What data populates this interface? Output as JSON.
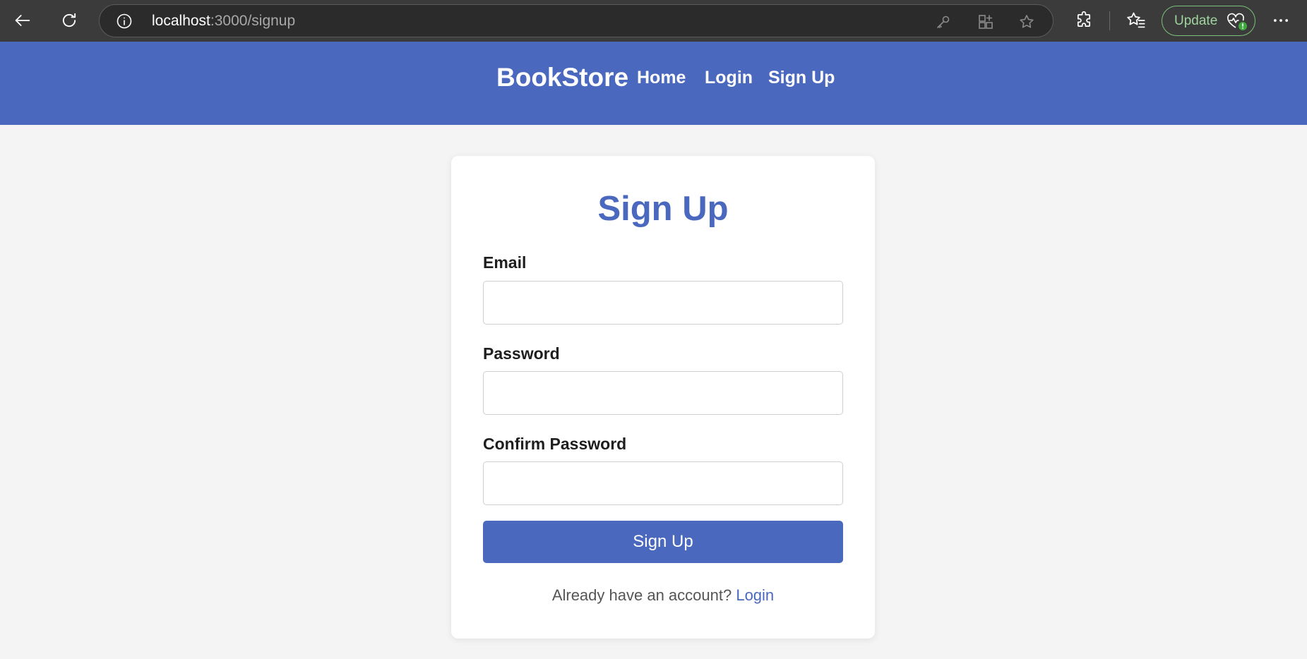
{
  "browser": {
    "url_host": "localhost",
    "url_path": ":3000/signup",
    "update_label": "Update",
    "icons": [
      "back-arrow-icon",
      "refresh-icon",
      "site-info-icon",
      "key-icon",
      "app-install-icon",
      "star-icon",
      "extensions-icon",
      "favorites-icon",
      "health-heart-icon",
      "more-icon"
    ],
    "accent_green": "#7ac27a"
  },
  "nav": {
    "brand": "BookStore",
    "links": [
      {
        "label": "Home"
      },
      {
        "label": "Login"
      },
      {
        "label": "Sign Up"
      }
    ],
    "background": "#4a68be"
  },
  "form": {
    "title": "Sign Up",
    "fields": [
      {
        "label": "Email",
        "value": "",
        "placeholder": ""
      },
      {
        "label": "Password",
        "value": "",
        "placeholder": ""
      },
      {
        "label": "Confirm Password",
        "value": "",
        "placeholder": ""
      }
    ],
    "submit_label": "Sign Up",
    "footer_text": "Already have an account? ",
    "footer_link": "Login",
    "accent": "#4a68be"
  }
}
